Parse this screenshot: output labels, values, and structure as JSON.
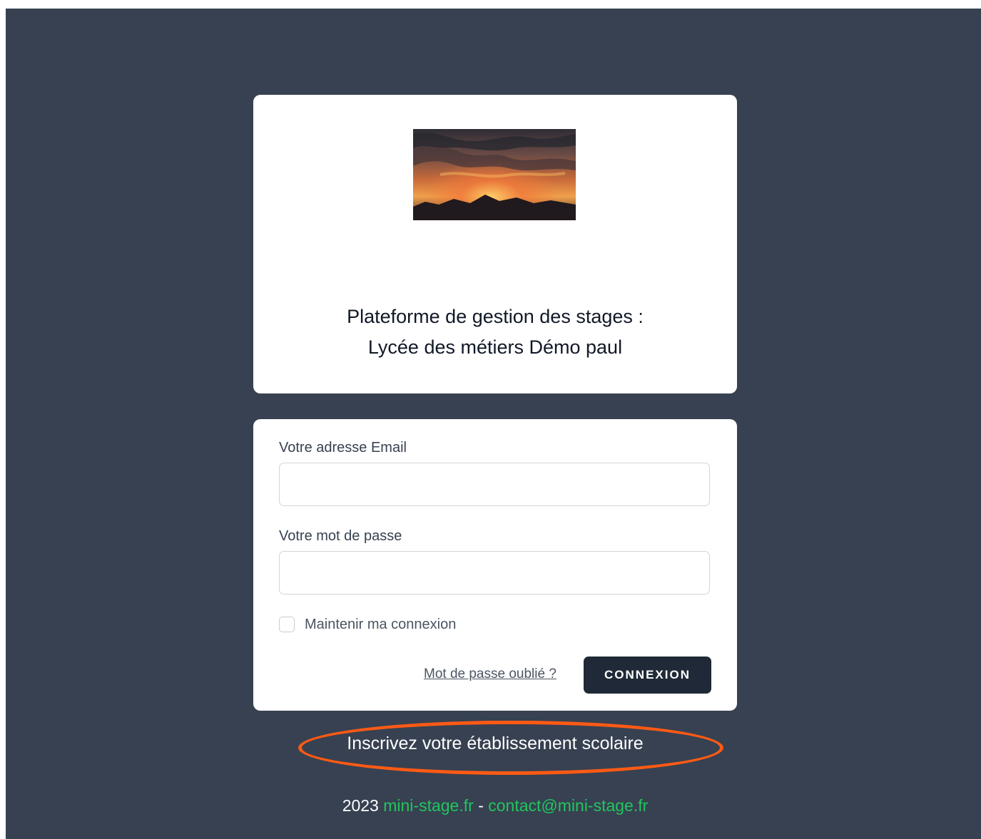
{
  "header": {
    "logo_alt": "Coucher de soleil sur des montagnes",
    "title_line_1": "Plateforme de gestion des stages :",
    "title_line_2": "Lycée des métiers Démo paul"
  },
  "login_form": {
    "email_label": "Votre adresse Email",
    "email_value": "",
    "password_label": "Votre mot de passe",
    "password_value": "",
    "remember_label": "Maintenir ma connexion",
    "remember_checked": false,
    "forgot_password_label": "Mot de passe oublié ?",
    "submit_label": "CONNEXION"
  },
  "register_link": {
    "label": "Inscrivez votre établissement scolaire"
  },
  "footer": {
    "year": "2023",
    "site_link": "mini-stage.fr",
    "separator": "-",
    "contact_link": "contact@mini-stage.fr"
  },
  "colors": {
    "page_background": "#374151",
    "card_background": "#ffffff",
    "button_background": "#1f2937",
    "link_green": "#22c55e",
    "annotation_orange": "#ff5a14"
  }
}
